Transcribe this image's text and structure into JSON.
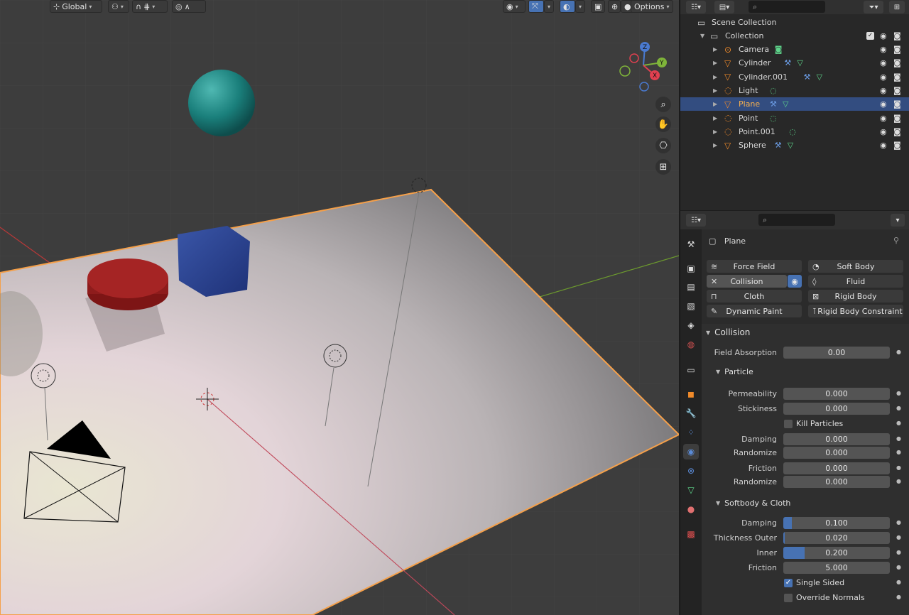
{
  "viewport": {
    "orientation_label": "Global",
    "options_label": "Options",
    "colors": {
      "background": "#3d3d3d",
      "plane_outline": "#f5a04a",
      "x_axis": "#b83838",
      "y_axis": "#6c9a2e"
    }
  },
  "outliner": {
    "search_placeholder": "",
    "scene_collection": "Scene Collection",
    "collection": "Collection",
    "objects": [
      {
        "name": "Camera",
        "icon": "camera-icon",
        "modifiers": [
          "camera-data-icon"
        ],
        "selected": false
      },
      {
        "name": "Cylinder",
        "icon": "mesh-icon",
        "modifiers": [
          "wrench-icon",
          "mesh-data-icon"
        ],
        "selected": false
      },
      {
        "name": "Cylinder.001",
        "icon": "mesh-icon",
        "modifiers": [
          "wrench-icon",
          "mesh-data-icon"
        ],
        "selected": false
      },
      {
        "name": "Light",
        "icon": "light-icon",
        "modifiers": [
          "light-data-icon"
        ],
        "selected": false
      },
      {
        "name": "Plane",
        "icon": "mesh-icon",
        "modifiers": [
          "wrench-icon",
          "mesh-data-icon"
        ],
        "selected": true
      },
      {
        "name": "Point",
        "icon": "light-icon",
        "modifiers": [
          "light-data-icon"
        ],
        "selected": false
      },
      {
        "name": "Point.001",
        "icon": "light-icon",
        "modifiers": [
          "light-data-icon"
        ],
        "selected": false
      },
      {
        "name": "Sphere",
        "icon": "mesh-icon",
        "modifiers": [
          "wrench-icon",
          "mesh-data-icon"
        ],
        "selected": false
      }
    ]
  },
  "properties": {
    "object_name": "Plane",
    "physics_buttons": {
      "force_field": "Force Field",
      "soft_body": "Soft Body",
      "collision": "Collision",
      "fluid": "Fluid",
      "cloth": "Cloth",
      "rigid_body": "Rigid Body",
      "dynamic_paint": "Dynamic Paint",
      "rigid_body_constraint": "Rigid Body Constraint"
    },
    "collision_panel": {
      "title": "Collision",
      "field_absorption_label": "Field Absorption",
      "field_absorption": "0.00"
    },
    "particle_panel": {
      "title": "Particle",
      "permeability_label": "Permeability",
      "permeability": "0.000",
      "stickiness_label": "Stickiness",
      "stickiness": "0.000",
      "kill_particles_label": "Kill Particles",
      "kill_particles": false,
      "damping_label": "Damping",
      "damping": "0.000",
      "damping_randomize_label": "Randomize",
      "damping_randomize": "0.000",
      "friction_label": "Friction",
      "friction": "0.000",
      "friction_randomize_label": "Randomize",
      "friction_randomize": "0.000"
    },
    "softbody_panel": {
      "title": "Softbody & Cloth",
      "damping_label": "Damping",
      "damping": "0.100",
      "damping_fill": 0.05,
      "thickness_outer_label": "Thickness Outer",
      "thickness_outer": "0.020",
      "thickness_outer_fill": 0.01,
      "inner_label": "Inner",
      "inner": "0.200",
      "inner_fill": 0.2,
      "friction_label": "Friction",
      "friction": "5.000",
      "single_sided_label": "Single Sided",
      "single_sided": true,
      "override_normals_label": "Override Normals",
      "override_normals": false
    },
    "accent_color": "#4772b3"
  }
}
